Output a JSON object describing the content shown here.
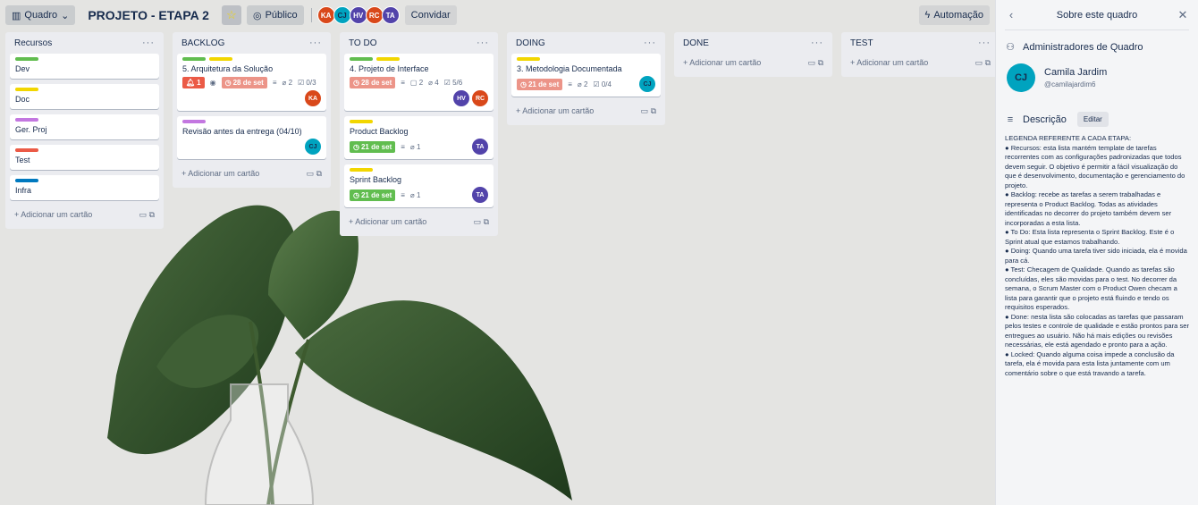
{
  "header": {
    "view_switch": "Quadro",
    "board_title": "PROJETO - ETAPA 2",
    "star": "☆",
    "visibility": "Público",
    "invite": "Convidar",
    "automation": "Automação",
    "members": [
      {
        "initials": "KA",
        "color": "#d9481a"
      },
      {
        "initials": "CJ",
        "color": "#00a3bf"
      },
      {
        "initials": "HV",
        "color": "#5243aa"
      },
      {
        "initials": "RC",
        "color": "#d9481a"
      },
      {
        "initials": "TA",
        "color": "#5243aa"
      }
    ]
  },
  "colors": {
    "green": "#61bd4f",
    "yellow": "#f2d600",
    "purple": "#c377e0",
    "red": "#eb5a46",
    "blue": "#0079bf",
    "due_red": "#eb5a46",
    "due_soon": "#ec9488",
    "due_green": "#61bd4f"
  },
  "lists": {
    "recursos": {
      "title": "Recursos",
      "cards": [
        "Dev",
        "Doc",
        "Ger. Proj",
        "Test",
        "Infra"
      ],
      "add": "Adicionar um cartão"
    },
    "backlog": {
      "title": "BACKLOG",
      "c1": {
        "title": "5. Arquitetura da Solução",
        "notif": "1",
        "due": "28 de set",
        "attach": "2",
        "check": "0/3",
        "member": "KA"
      },
      "c2": {
        "title": "Revisão antes da entrega (04/10)",
        "member": "CJ"
      },
      "add": "Adicionar um cartão"
    },
    "todo": {
      "title": "TO DO",
      "c1": {
        "title": "4. Projeto de Interface",
        "due": "28 de set",
        "comments": "2",
        "attach": "4",
        "check": "5/6",
        "m1": "HV",
        "m2": "RC"
      },
      "c2": {
        "title": "Product Backlog",
        "due": "21 de set",
        "attach": "1",
        "member": "TA"
      },
      "c3": {
        "title": "Sprint Backlog",
        "due": "21 de set",
        "attach": "1",
        "member": "TA"
      },
      "add": "Adicionar um cartão"
    },
    "doing": {
      "title": "DOING",
      "c1": {
        "title": "3. Metodologia Documentada",
        "due": "21 de set",
        "attach": "2",
        "check": "0/4",
        "member": "CJ"
      },
      "add": "Adicionar um cartão"
    },
    "done": {
      "title": "DONE",
      "add": "Adicionar um cartão"
    },
    "test": {
      "title": "TEST",
      "add": "Adicionar um cartão"
    }
  },
  "side": {
    "title": "Sobre este quadro",
    "admins_title": "Administradores de Quadro",
    "admin_name": "Camila Jardim",
    "admin_user": "@camilajardim6",
    "admin_initials": "CJ",
    "desc_title": "Descrição",
    "edit": "Editar",
    "desc_lines": [
      "LEGENDA REFERENTE A CADA ETAPA:",
      "● Recursos: esta lista mantém template de tarefas recorrentes com as configurações padronizadas que todos devem seguir. O objetivo é permitir a fácil visualização do que é desenvolvimento, documentação e gerenciamento do projeto.",
      "● Backlog: recebe as tarefas a serem trabalhadas e representa o Product Backlog. Todas as atividades identificadas no decorrer do projeto também devem ser incorporadas a esta lista.",
      "● To Do: Esta lista representa o Sprint Backlog. Este é o Sprint atual que estamos trabalhando.",
      "● Doing: Quando uma tarefa tiver sido iniciada, ela é movida para cá.",
      "● Test: Checagem de Qualidade. Quando as tarefas são concluídas, eles são movidas para o test. No decorrer da semana, o Scrum Master com o Product Owen checam a lista para garantir que o projeto está fluindo e tendo os requisitos esperados.",
      "● Done: nesta lista são colocadas as tarefas que passaram pelos testes e controle de qualidade e estão prontos para ser entregues ao usuário. Não há mais edições ou revisões necessárias, ele está agendado e pronto para a ação.",
      "● Locked: Quando alguma coisa impede a conclusão da tarefa, ela é movida para esta lista juntamente com um comentário sobre o que está travando a tarefa."
    ]
  }
}
